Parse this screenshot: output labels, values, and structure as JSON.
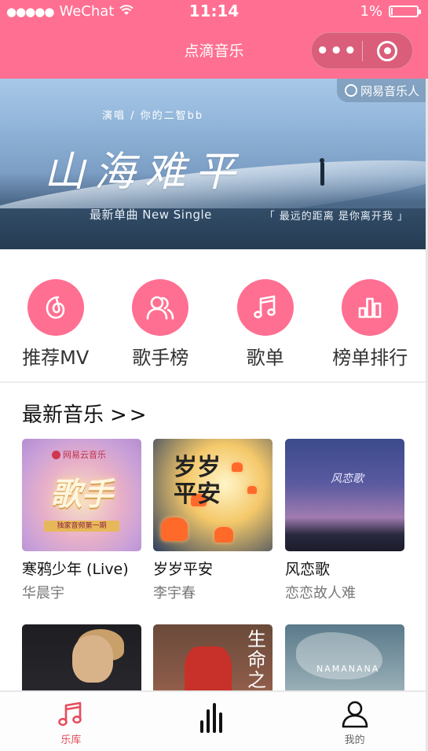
{
  "status_bar": {
    "signal": "●●●●●",
    "carrier": "WeChat",
    "time": "11:14",
    "battery": "1%"
  },
  "nav": {
    "title": "点滴音乐",
    "more": "•••"
  },
  "banner": {
    "tag": "网易音乐人",
    "singer": "演唱 / 你的二智bb",
    "title": "山海难平",
    "subtitle": "最新单曲  New  Single",
    "quote": "「 最远的距离  是你离开我 」"
  },
  "quicknav": [
    {
      "label": "推荐MV",
      "icon": "netease-music-icon"
    },
    {
      "label": "歌手榜",
      "icon": "singers-icon"
    },
    {
      "label": "歌单",
      "icon": "music-note-icon"
    },
    {
      "label": "榜单排行",
      "icon": "bar-chart-icon"
    }
  ],
  "latest": {
    "title": "最新音乐",
    "arrow": ">>",
    "songs": [
      {
        "name": "寒鸦少年 (Live)",
        "artist": "华晨宇",
        "cover": {
          "brand": "网易云音乐",
          "big": "歌手",
          "strip": "独家音频第一期"
        }
      },
      {
        "name": "岁岁平安",
        "artist": "李宇春",
        "cover": {
          "text": "岁岁平安"
        }
      },
      {
        "name": "风恋歌",
        "artist": "恋恋故人难",
        "cover": {
          "text": "风恋歌"
        }
      },
      {
        "name": "",
        "artist": "",
        "cover": {}
      },
      {
        "name": "",
        "artist": "",
        "cover": {
          "text": "生命之"
        }
      },
      {
        "name": "",
        "artist": "",
        "cover": {
          "text": "NAMANANA"
        }
      }
    ]
  },
  "tabbar": {
    "items": [
      {
        "label": "乐库",
        "active": true,
        "icon": "music-note-icon"
      },
      {
        "label": "",
        "active": false,
        "icon": "equalizer-icon"
      },
      {
        "label": "我的",
        "active": false,
        "icon": "user-icon"
      }
    ]
  },
  "colors": {
    "brand": "#ff6f91",
    "active_tab": "#e64c5c"
  }
}
